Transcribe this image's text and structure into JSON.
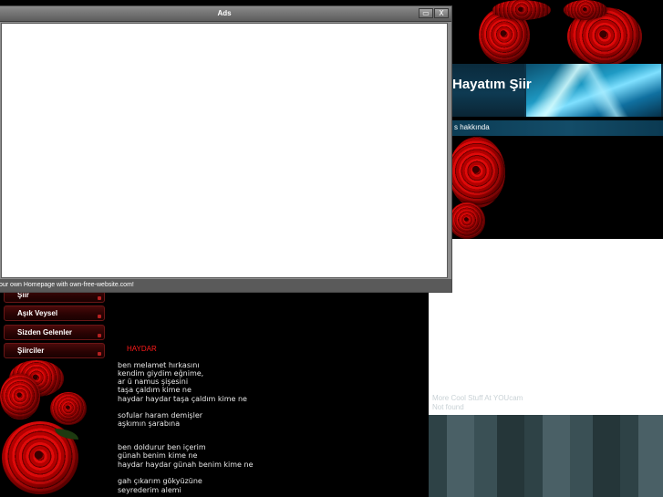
{
  "site": {
    "title": "Hayatım Şiir",
    "about_link": "s hakkında",
    "promo_text_line1": "More Cool Stuff At YOUcam",
    "promo_text_line2": "Not found"
  },
  "nav": {
    "items": [
      "Şiir",
      "Aşık Veysel",
      "Sizden Gelenler",
      "Şiirciler"
    ]
  },
  "poem": {
    "title": "HAYDAR",
    "lines": [
      "ben melamet hırkasını",
      "kendim giydim eğnime,",
      "ar ü namus şişesini",
      "taşa çaldım kime ne",
      "haydar haydar taşa çaldım kime ne",
      "sofular haram demişler",
      "aşkımın şarabına",
      "ben doldurur ben içerim",
      "günah benim kime ne",
      "haydar haydar günah benim kime ne",
      "gah çıkarım gökyüzüne",
      "seyrederim alemi"
    ]
  },
  "ads_window": {
    "title": "Ads",
    "minimize_glyph": "▭",
    "close_glyph": "X",
    "status_text": "our own Homepage with own-free-website.com!"
  }
}
